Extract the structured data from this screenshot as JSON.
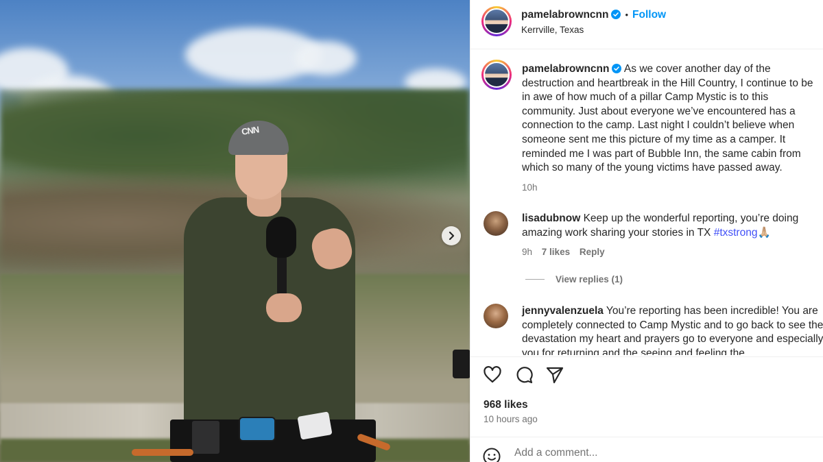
{
  "post": {
    "author": "pamelabrowncnn",
    "location": "Kerrville, Texas",
    "follow_label": "Follow",
    "separator": "•",
    "cap_logo": "CNN",
    "caption": "As we cover another day of the destruction and heartbreak in the Hill Country, I continue to be in awe of how much of a pillar Camp Mystic is to this community. Just about everyone we’ve encountered has a connection to the camp. Last night I couldn’t believe when someone sent me this picture of my time as a camper. It reminded me I was part of Bubble Inn, the same cabin from which so many of the young victims have passed away.",
    "caption_time": "10h",
    "likes": "968 likes",
    "time_ago": "10 hours ago"
  },
  "comments": [
    {
      "user": "lisadubnow",
      "text": "Keep up the wonderful reporting, you’re doing amazing work sharing your stories in TX",
      "hashtag": "#txstrong",
      "emoji": "🙏🏼",
      "time": "9h",
      "likes": "7 likes",
      "reply_label": "Reply",
      "view_replies": "View replies (1)"
    },
    {
      "user": "jennyvalenzuela",
      "text": "You’re reporting has been incredible! You are completely connected to Camp Mystic and to go back to see the devastation my heart and prayers go to everyone and especially you for returning and the seeing and feeling the"
    }
  ],
  "add_comment": {
    "placeholder": "Add a comment..."
  },
  "icons": {
    "verified": "verified-badge-icon",
    "next": "chevron-right-icon",
    "like": "heart-icon",
    "comment": "comment-bubble-icon",
    "share": "paper-plane-icon",
    "emoji": "smiley-icon"
  },
  "colors": {
    "follow": "#0095f6",
    "hashtag": "#4150f7",
    "muted": "#737373"
  }
}
